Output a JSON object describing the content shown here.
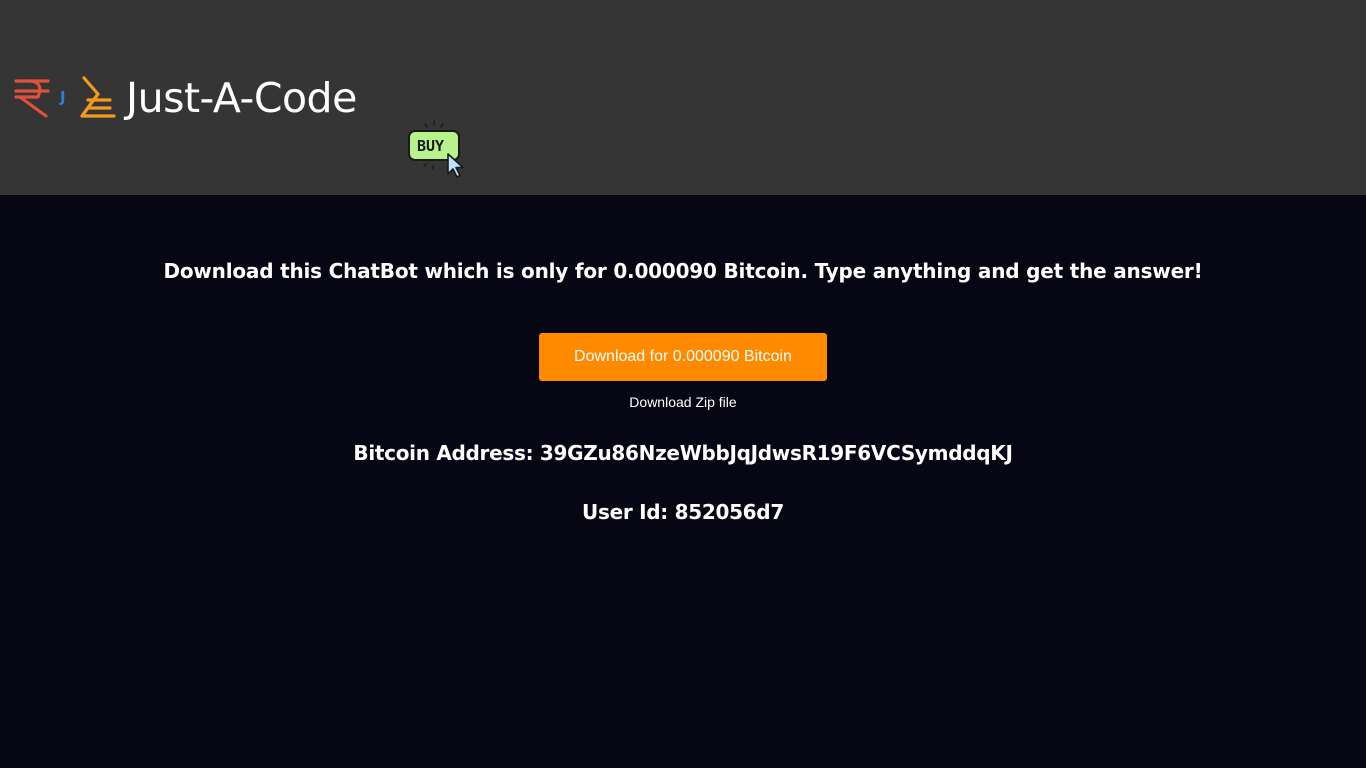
{
  "header": {
    "logo_text": "Just-A-Code",
    "logo_icon": "rupee-j-rupee-logo-icon",
    "buy_label": "BUY",
    "buy_icon": "buy-cursor-icon"
  },
  "main": {
    "tagline": "Download this ChatBot which is only for 0.000090 Bitcoin. Type anything and get the answer!",
    "download_button_label": "Download for 0.000090 Bitcoin",
    "zip_link_label": "Download Zip file",
    "bitcoin_address": "Bitcoin Address: 39GZu86NzeWbbJqJdwsR19F6VCSymddqKJ",
    "user_id": "User Id: 852056d7"
  },
  "colors": {
    "header_bg": "#353535",
    "page_bg": "#070614",
    "button_bg": "#ff8a00",
    "buy_badge": "#b7f28a"
  }
}
